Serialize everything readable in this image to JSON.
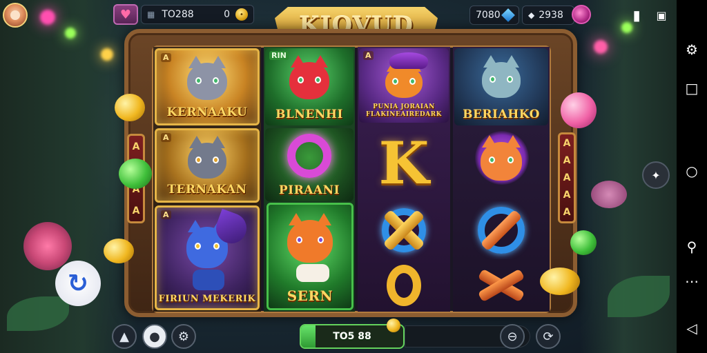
{
  "game_title": "KIOVUD",
  "top_bar": {
    "player_id": "TO288",
    "balance": "0",
    "gem_count": "7080",
    "second_currency": "2938"
  },
  "reels": [
    [
      {
        "label": "KERNAAKU",
        "corner": "A"
      },
      {
        "label": "TERNAKAN",
        "corner": "A"
      },
      {
        "label": "FIRIUN MEKERIK",
        "corner": "A"
      }
    ],
    [
      {
        "label": "BLNENHI",
        "corner": "RIN"
      },
      {
        "label": "PIRAANI",
        "corner": ""
      },
      {
        "label": "SERN",
        "corner": ""
      }
    ],
    [
      {
        "label": "PUNIA JORAIAN FLAKINEAIREDARK",
        "corner": "A"
      },
      {
        "label": "K",
        "corner": ""
      },
      {
        "label": "",
        "corner": ""
      },
      {
        "label": "",
        "corner": ""
      }
    ],
    [
      {
        "label": "BERIAHKO",
        "corner": ""
      },
      {
        "label": "",
        "corner": ""
      },
      {
        "label": "",
        "corner": ""
      }
    ]
  ],
  "side_tabs": {
    "left": [
      "A",
      "A",
      "A",
      "A"
    ],
    "right": [
      "A",
      "A",
      "A",
      "A",
      "A"
    ]
  },
  "bottom_bar": {
    "spin_label": "TO5 88",
    "spin_progress": 0.14
  },
  "icons": {
    "heart": "heart-icon",
    "refresh": "refresh-icon",
    "home": "home-icon"
  },
  "colors": {
    "accent_gold": "#f6c334",
    "accent_green": "#47c04a",
    "frame_wood": "#8c5d31"
  }
}
